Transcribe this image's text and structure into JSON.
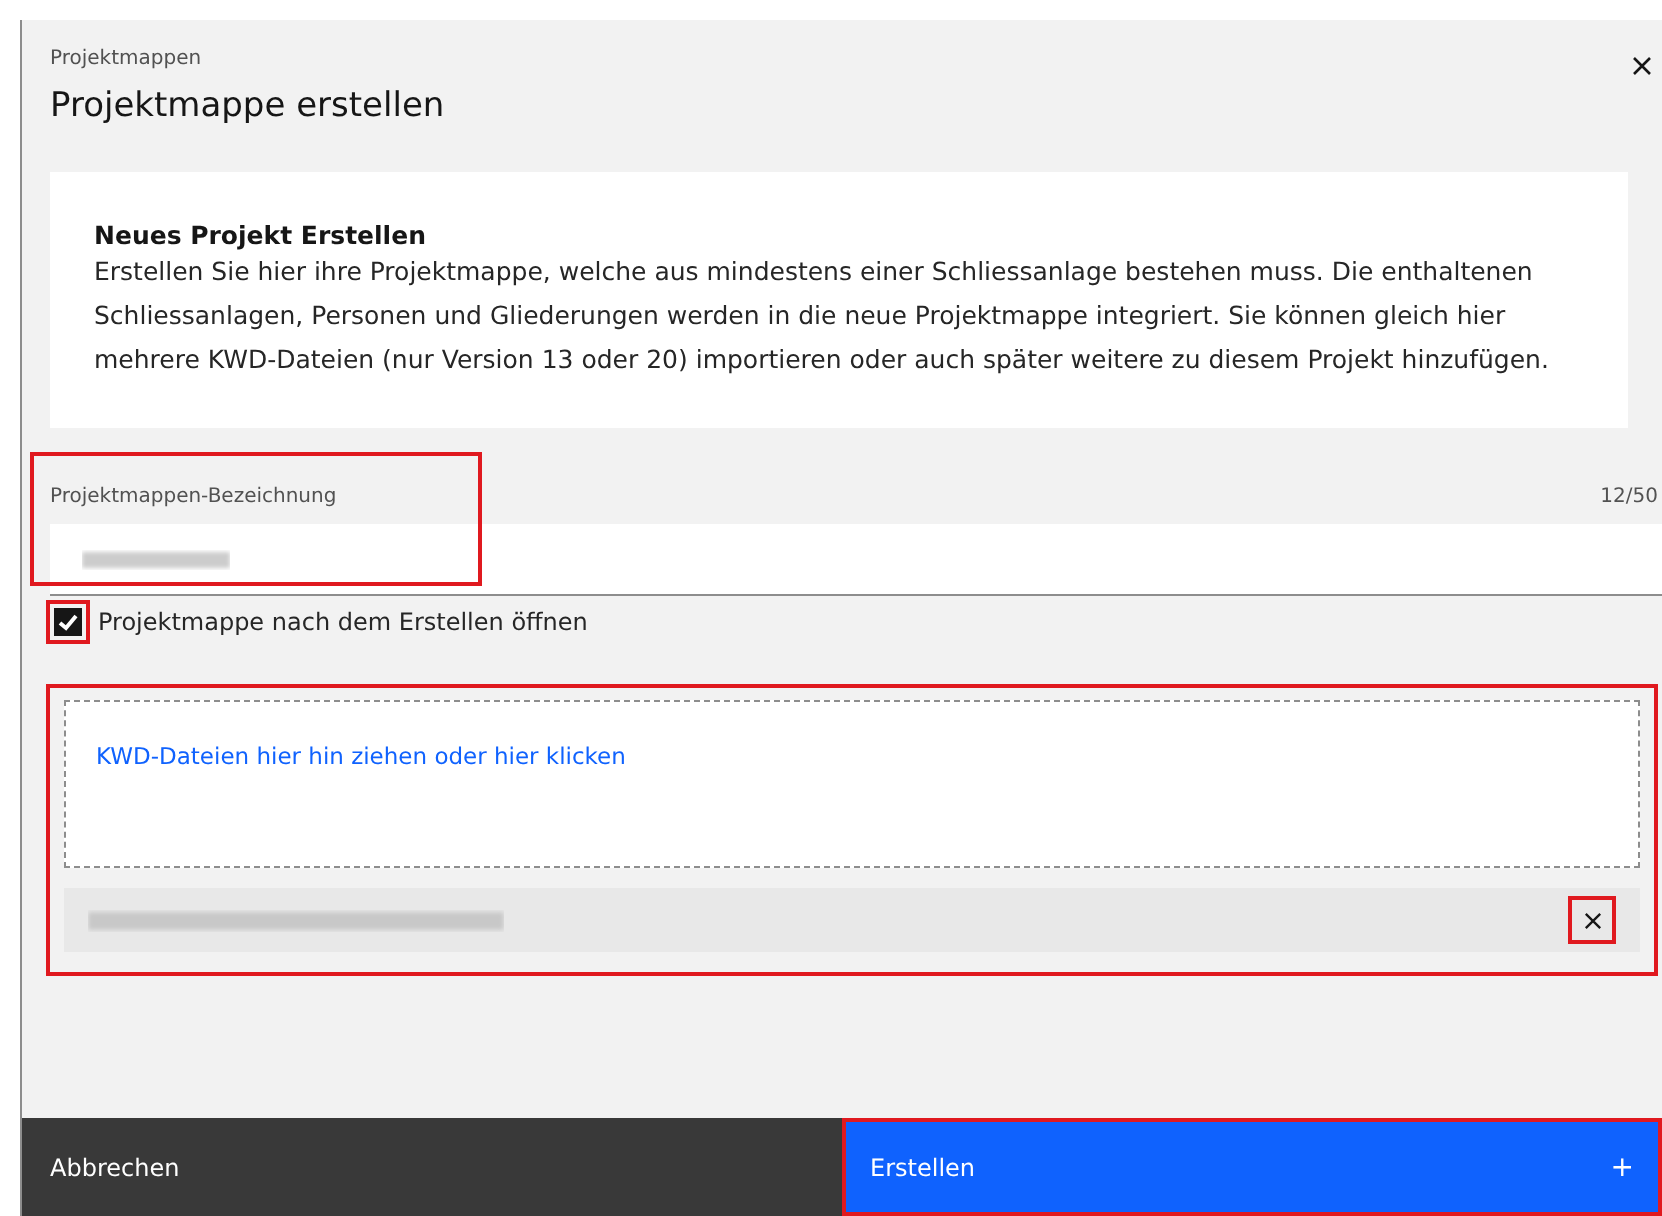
{
  "dialog": {
    "label": "Projektmappen",
    "title": "Projektmappe erstellen"
  },
  "info": {
    "heading": "Neues Projekt Erstellen",
    "text": "Erstellen Sie hier ihre Projektmappe, welche aus mindestens einer Schliessanlage bestehen muss. Die enthaltenen Schliessanlagen, Personen und Gliederungen werden in die neue Projektmappe integriert. Sie können gleich hier mehrere KWD-Dateien (nur Version 13 oder 20) importieren oder auch später weitere zu diesem Projekt hinzufügen."
  },
  "name_field": {
    "label": "Projektmappen-Bezeichnung",
    "counter": "12/50",
    "highlighted": true
  },
  "open_checkbox": {
    "label": "Projektmappe nach dem Erstellen öffnen",
    "checked": true,
    "highlighted": true
  },
  "dropzone": {
    "prompt": "KWD-Dateien hier hin ziehen oder hier klicken",
    "highlighted": true,
    "remove_highlighted": true
  },
  "buttons": [
    {
      "label": "Abbrechen",
      "kind": "secondary",
      "highlighted": false
    },
    {
      "label": "Erstellen",
      "kind": "primary",
      "highlighted": true,
      "icon": "+"
    }
  ]
}
